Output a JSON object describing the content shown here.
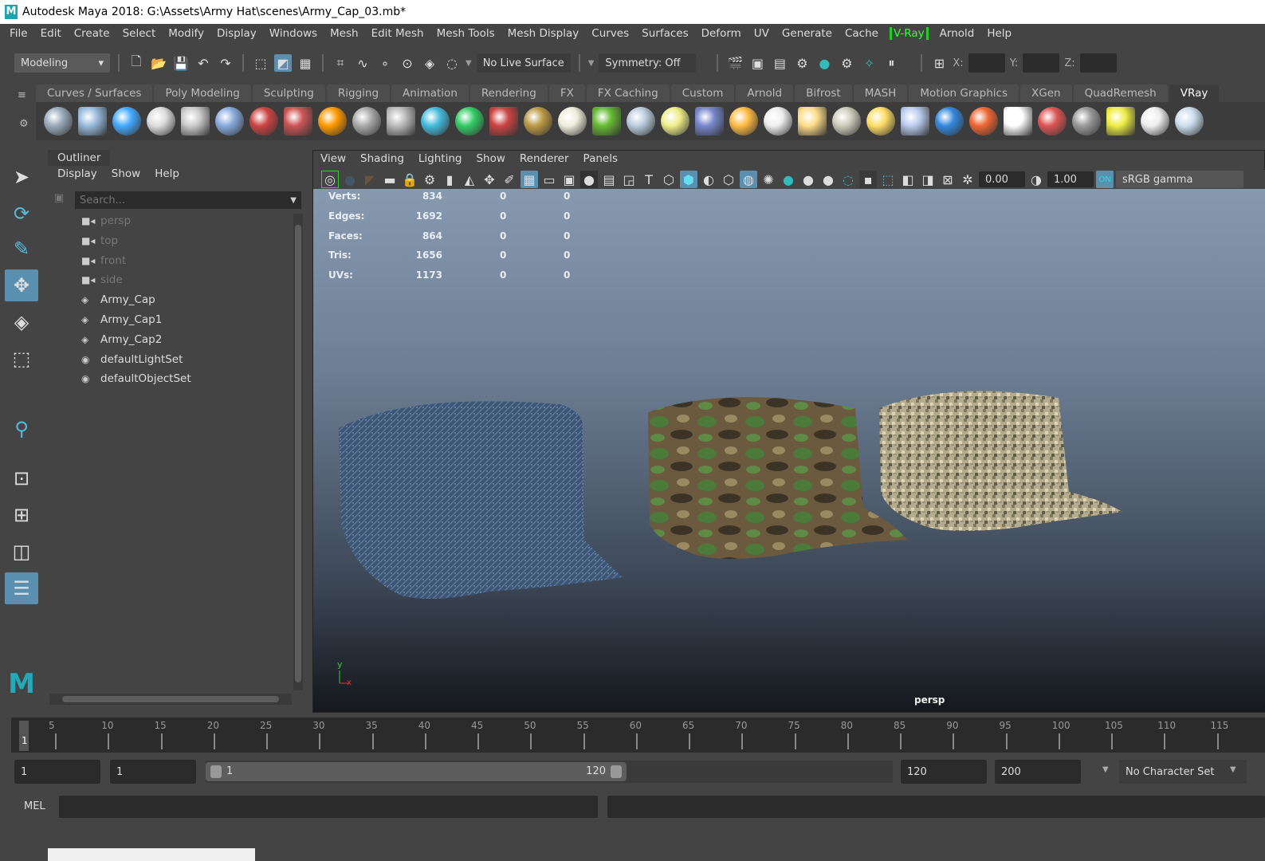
{
  "window": {
    "title": "Autodesk Maya 2018: G:\\Assets\\Army Hat\\scenes\\Army_Cap_03.mb*",
    "logo": "M"
  },
  "menubar": [
    "File",
    "Edit",
    "Create",
    "Select",
    "Modify",
    "Display",
    "Windows",
    "Mesh",
    "Edit Mesh",
    "Mesh Tools",
    "Mesh Display",
    "Curves",
    "Surfaces",
    "Deform",
    "UV",
    "Generate",
    "Cache",
    "V-Ray",
    "Arnold",
    "Help"
  ],
  "statusline": {
    "workspace": "Modeling",
    "live_surface": "No Live Surface",
    "symmetry": "Symmetry: Off",
    "x_label": "X:",
    "y_label": "Y:",
    "z_label": "Z:"
  },
  "shelf": {
    "tabs": [
      "Curves / Surfaces",
      "Poly Modeling",
      "Sculpting",
      "Rigging",
      "Animation",
      "Rendering",
      "FX",
      "FX Caching",
      "Custom",
      "Arnold",
      "Bifrost",
      "MASH",
      "Motion Graphics",
      "XGen",
      "QuadRemesh",
      "VRay"
    ],
    "active_tab": "VRay",
    "icons": [
      "vray-settings-icon",
      "vray-render-icon",
      "vray-frame-buffer-icon",
      "vray-logo-icon",
      "vray-doc-icon",
      "vray-material-icon",
      "vray-camera-icon",
      "vray-spheres-icon",
      "vray-fire-icon",
      "vray-plane-icon",
      "vray-box-icon",
      "vray-fur-icon",
      "vray-water-icon",
      "vray-proxy-icon",
      "vray-grid-icon",
      "vray-dome-icon",
      "vray-grass-icon",
      "vray-particle-icon",
      "vray-curve-icon",
      "vray-sphere-light-icon",
      "vray-half-dome-icon",
      "vray-spot-icon",
      "vray-omni-icon",
      "vray-cone-icon",
      "vray-sun-icon",
      "vray-rect-light-icon",
      "vray-blue-sphere-icon",
      "vray-flag-icon",
      "vray-checker-icon",
      "vray-vfb-icon",
      "vray-table-icon",
      "vray-bulb-icon",
      "vray-cloud-icon",
      "help-icon"
    ]
  },
  "outliner": {
    "title": "Outliner",
    "menu": [
      "Display",
      "Show",
      "Help"
    ],
    "search_placeholder": "Search...",
    "items": [
      {
        "label": "persp",
        "type": "camera",
        "dim": true
      },
      {
        "label": "top",
        "type": "camera",
        "dim": true
      },
      {
        "label": "front",
        "type": "camera",
        "dim": true
      },
      {
        "label": "side",
        "type": "camera",
        "dim": true
      },
      {
        "label": "Army_Cap",
        "type": "mesh",
        "dim": false
      },
      {
        "label": "Army_Cap1",
        "type": "mesh",
        "dim": false
      },
      {
        "label": "Army_Cap2",
        "type": "mesh",
        "dim": false
      },
      {
        "label": "defaultLightSet",
        "type": "set",
        "dim": false
      },
      {
        "label": "defaultObjectSet",
        "type": "set",
        "dim": false
      }
    ]
  },
  "viewport": {
    "menu": [
      "View",
      "Shading",
      "Lighting",
      "Show",
      "Renderer",
      "Panels"
    ],
    "exposure": "0.00",
    "gamma": "1.00",
    "colorspace": "sRGB gamma",
    "camera_label": "persp",
    "axis_y": "y",
    "axis_x": "x",
    "hud": [
      {
        "label": "Verts:",
        "a": "834",
        "b": "0",
        "c": "0"
      },
      {
        "label": "Edges:",
        "a": "1692",
        "b": "0",
        "c": "0"
      },
      {
        "label": "Faces:",
        "a": "864",
        "b": "0",
        "c": "0"
      },
      {
        "label": "Tris:",
        "a": "1656",
        "b": "0",
        "c": "0"
      },
      {
        "label": "UVs:",
        "a": "1173",
        "b": "0",
        "c": "0"
      }
    ]
  },
  "timeline": {
    "current_frame": "1",
    "ticks": [
      "5",
      "10",
      "15",
      "20",
      "25",
      "30",
      "35",
      "40",
      "45",
      "50",
      "55",
      "60",
      "65",
      "70",
      "75",
      "80",
      "85",
      "90",
      "95",
      "100",
      "105",
      "110",
      "115"
    ]
  },
  "range": {
    "start": "1",
    "current": "1",
    "slider_start": "1",
    "slider_end": "120",
    "end": "120",
    "anim_end": "200",
    "character_set": "No Character Set"
  },
  "command": {
    "label": "MEL"
  }
}
